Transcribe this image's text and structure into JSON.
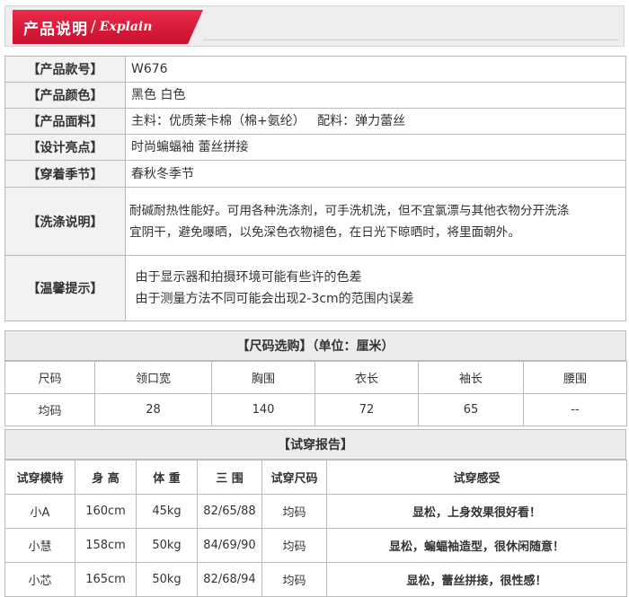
{
  "banner": {
    "cn": "产品说明",
    "sep": "/",
    "en": "Explain"
  },
  "info": [
    {
      "label": "【产品款号】",
      "lines": [
        "W676"
      ]
    },
    {
      "label": "【产品颜色】",
      "lines": [
        "黑色 白色"
      ]
    },
    {
      "label": "【产品面料】",
      "lines": [
        "主料：优质莱卡棉（棉+氨纶）   配料：弹力蕾丝"
      ]
    },
    {
      "label": "【设计亮点】",
      "lines": [
        "时尚蝙蝠袖 蕾丝拼接"
      ]
    },
    {
      "label": "【穿着季节】",
      "lines": [
        "春秋冬季节"
      ]
    },
    {
      "label": "【洗涤说明】",
      "lines": [
        "耐碱耐热性能好。可用各种洗涤剂，可手洗机洗，但不宜氯漂与其他衣物分开洗涤",
        "宜阴干，避免曝晒，以免深色衣物褪色，在日光下晾晒时，将里面朝外。"
      ]
    },
    {
      "label": "【温馨提示】",
      "lines": [
        " 由于显示器和拍摄环境可能有些许的色差",
        " 由于测量方法不同可能会出现2-3cm的范围内误差"
      ]
    }
  ],
  "size_section": {
    "title": "【尺码选购】（单位：厘米）"
  },
  "size_table": {
    "headers": [
      "尺码",
      "领口宽",
      "胸围",
      "衣长",
      "袖长",
      "腰围"
    ],
    "rows": [
      [
        "均码",
        "28",
        "140",
        "72",
        "65",
        "--"
      ]
    ]
  },
  "fit_section": {
    "title": "【试穿报告】"
  },
  "fit_table": {
    "headers": [
      "试穿模特",
      "身 高",
      "体 重",
      "三 围",
      "试穿尺码",
      "试穿感受"
    ],
    "rows": [
      [
        "小A",
        "160cm",
        "45kg",
        "82/65/88",
        "均码",
        "显松，上身效果很好看！"
      ],
      [
        "小慧",
        "158cm",
        "50kg",
        "84/69/90",
        "均码",
        "显松，蝙蝠袖造型，很休闲随意！"
      ],
      [
        "小芯",
        "165cm",
        "50kg",
        "82/68/94",
        "均码",
        "显松，蕾丝拼接，很性感！"
      ]
    ]
  }
}
